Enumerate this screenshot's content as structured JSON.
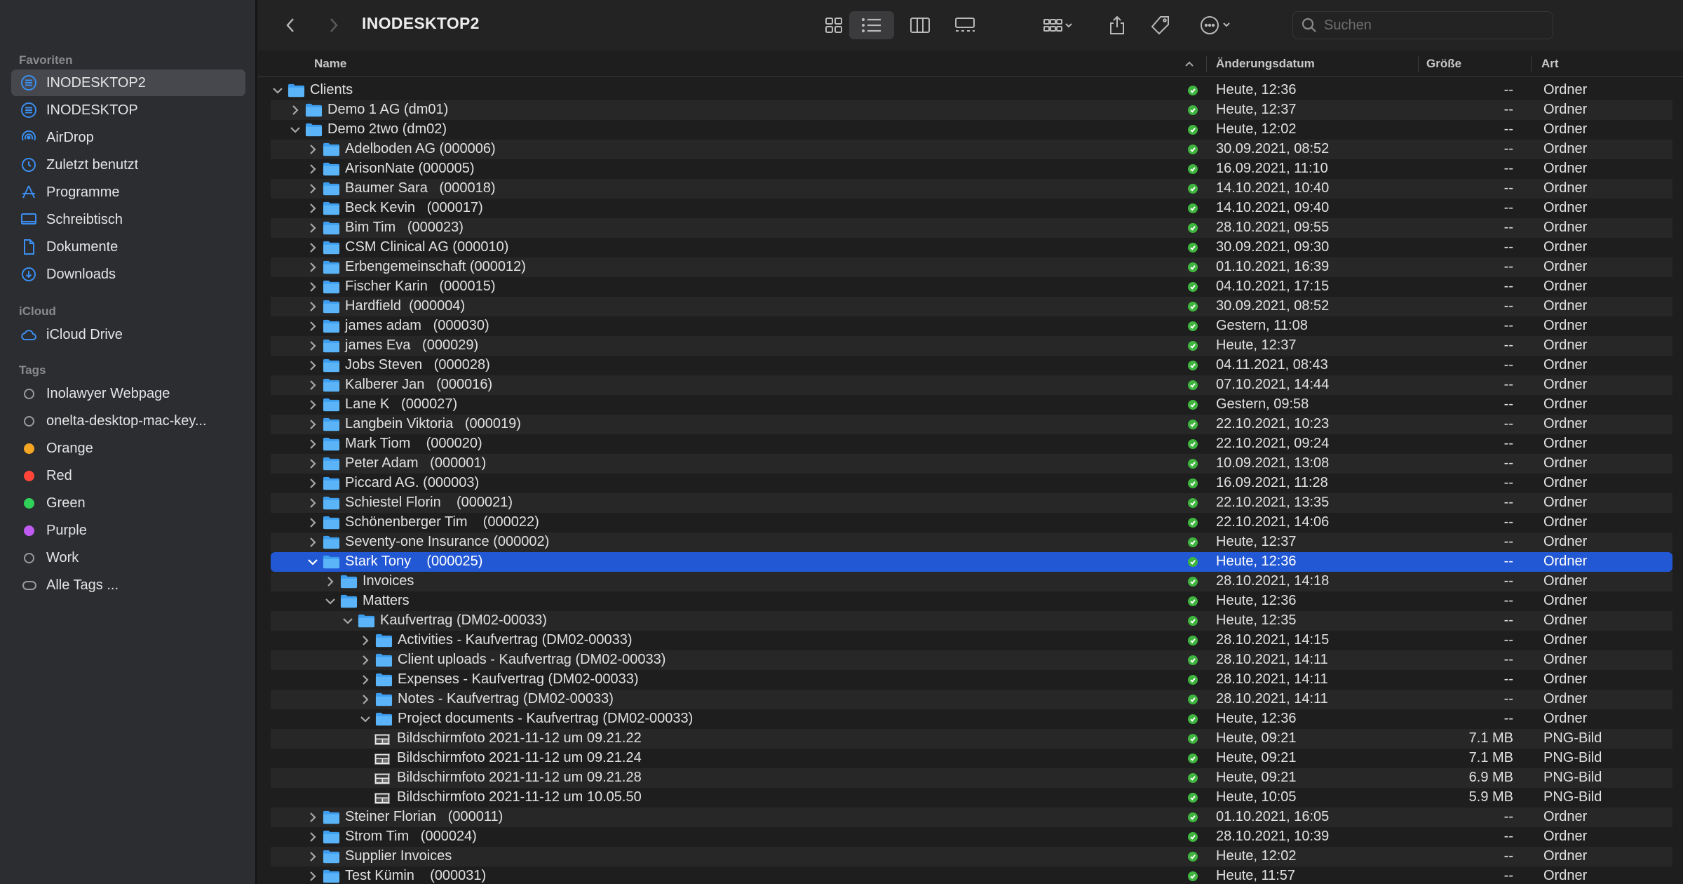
{
  "sidebar": {
    "favorites_title": "Favoriten",
    "favorites": [
      {
        "label": "INODESKTOP2",
        "icon": "server-icon",
        "active": true
      },
      {
        "label": "INODESKTOP",
        "icon": "server-icon",
        "active": false
      },
      {
        "label": "AirDrop",
        "icon": "airdrop-icon",
        "active": false
      },
      {
        "label": "Zuletzt benutzt",
        "icon": "clock-icon",
        "active": false
      },
      {
        "label": "Programme",
        "icon": "apps-icon",
        "active": false
      },
      {
        "label": "Schreibtisch",
        "icon": "desktop-icon",
        "active": false
      },
      {
        "label": "Dokumente",
        "icon": "document-icon",
        "active": false
      },
      {
        "label": "Downloads",
        "icon": "download-icon",
        "active": false
      }
    ],
    "icloud_title": "iCloud",
    "icloud": [
      {
        "label": "iCloud Drive",
        "icon": "cloud-icon"
      }
    ],
    "tags_title": "Tags",
    "tags": [
      {
        "label": "Inolawyer Webpage",
        "color": "none"
      },
      {
        "label": "onelta-desktop-mac-key...",
        "color": "none"
      },
      {
        "label": "Orange",
        "color": "#f5a623"
      },
      {
        "label": "Red",
        "color": "#ff453a"
      },
      {
        "label": "Green",
        "color": "#30d158"
      },
      {
        "label": "Purple",
        "color": "#bf5af2"
      },
      {
        "label": "Work",
        "color": "none"
      },
      {
        "label": "Alle Tags ...",
        "color": "all"
      }
    ]
  },
  "toolbar": {
    "title": "INODESKTOP2",
    "search_placeholder": "Suchen"
  },
  "columns": {
    "name": "Name",
    "date": "Änderungsdatum",
    "size": "Größe",
    "kind": "Art"
  },
  "rows": [
    {
      "name": "Clients",
      "level": 0,
      "expanded": true,
      "type": "folder",
      "date": "Heute, 12:36",
      "size": "--",
      "kind": "Ordner"
    },
    {
      "name": "Demo 1 AG (dm01)",
      "level": 1,
      "expanded": false,
      "type": "folder",
      "date": "Heute, 12:37",
      "size": "--",
      "kind": "Ordner"
    },
    {
      "name": "Demo 2two (dm02)",
      "level": 1,
      "expanded": true,
      "type": "folder",
      "date": "Heute, 12:02",
      "size": "--",
      "kind": "Ordner"
    },
    {
      "name": "Adelboden AG (000006)",
      "level": 2,
      "expanded": false,
      "type": "folder",
      "date": "30.09.2021, 08:52",
      "size": "--",
      "kind": "Ordner"
    },
    {
      "name": "ArisonNate (000005)",
      "level": 2,
      "expanded": false,
      "type": "folder",
      "date": "16.09.2021, 11:10",
      "size": "--",
      "kind": "Ordner"
    },
    {
      "name": "Baumer Sara   (000018)",
      "level": 2,
      "expanded": false,
      "type": "folder",
      "date": "14.10.2021, 10:40",
      "size": "--",
      "kind": "Ordner"
    },
    {
      "name": "Beck Kevin   (000017)",
      "level": 2,
      "expanded": false,
      "type": "folder",
      "date": "14.10.2021, 09:40",
      "size": "--",
      "kind": "Ordner"
    },
    {
      "name": "Bim Tim   (000023)",
      "level": 2,
      "expanded": false,
      "type": "folder",
      "date": "28.10.2021, 09:55",
      "size": "--",
      "kind": "Ordner"
    },
    {
      "name": "CSM Clinical AG (000010)",
      "level": 2,
      "expanded": false,
      "type": "folder",
      "date": "30.09.2021, 09:30",
      "size": "--",
      "kind": "Ordner"
    },
    {
      "name": "Erbengemeinschaft (000012)",
      "level": 2,
      "expanded": false,
      "type": "folder",
      "date": "01.10.2021, 16:39",
      "size": "--",
      "kind": "Ordner"
    },
    {
      "name": "Fischer Karin   (000015)",
      "level": 2,
      "expanded": false,
      "type": "folder",
      "date": "04.10.2021, 17:15",
      "size": "--",
      "kind": "Ordner"
    },
    {
      "name": "Hardfield  (000004)",
      "level": 2,
      "expanded": false,
      "type": "folder",
      "date": "30.09.2021, 08:52",
      "size": "--",
      "kind": "Ordner"
    },
    {
      "name": "james adam   (000030)",
      "level": 2,
      "expanded": false,
      "type": "folder",
      "date": "Gestern, 11:08",
      "size": "--",
      "kind": "Ordner"
    },
    {
      "name": "james Eva   (000029)",
      "level": 2,
      "expanded": false,
      "type": "folder",
      "date": "Heute, 12:37",
      "size": "--",
      "kind": "Ordner"
    },
    {
      "name": "Jobs Steven   (000028)",
      "level": 2,
      "expanded": false,
      "type": "folder",
      "date": "04.11.2021, 08:43",
      "size": "--",
      "kind": "Ordner"
    },
    {
      "name": "Kalberer Jan   (000016)",
      "level": 2,
      "expanded": false,
      "type": "folder",
      "date": "07.10.2021, 14:44",
      "size": "--",
      "kind": "Ordner"
    },
    {
      "name": "Lane K   (000027)",
      "level": 2,
      "expanded": false,
      "type": "folder",
      "date": "Gestern, 09:58",
      "size": "--",
      "kind": "Ordner"
    },
    {
      "name": "Langbein Viktoria   (000019)",
      "level": 2,
      "expanded": false,
      "type": "folder",
      "date": "22.10.2021, 10:23",
      "size": "--",
      "kind": "Ordner"
    },
    {
      "name": "Mark Tiom    (000020)",
      "level": 2,
      "expanded": false,
      "type": "folder",
      "date": "22.10.2021, 09:24",
      "size": "--",
      "kind": "Ordner"
    },
    {
      "name": "Peter Adam   (000001)",
      "level": 2,
      "expanded": false,
      "type": "folder",
      "date": "10.09.2021, 13:08",
      "size": "--",
      "kind": "Ordner"
    },
    {
      "name": "Piccard AG. (000003)",
      "level": 2,
      "expanded": false,
      "type": "folder",
      "date": "16.09.2021, 11:28",
      "size": "--",
      "kind": "Ordner"
    },
    {
      "name": "Schiestel Florin    (000021)",
      "level": 2,
      "expanded": false,
      "type": "folder",
      "date": "22.10.2021, 13:35",
      "size": "--",
      "kind": "Ordner"
    },
    {
      "name": "Schönenberger Tim    (000022)",
      "level": 2,
      "expanded": false,
      "type": "folder",
      "date": "22.10.2021, 14:06",
      "size": "--",
      "kind": "Ordner"
    },
    {
      "name": "Seventy-one Insurance (000002)",
      "level": 2,
      "expanded": false,
      "type": "folder",
      "date": "Heute, 12:37",
      "size": "--",
      "kind": "Ordner"
    },
    {
      "name": "Stark Tony    (000025)",
      "level": 2,
      "expanded": true,
      "type": "folder",
      "selected": true,
      "date": "Heute, 12:36",
      "size": "--",
      "kind": "Ordner"
    },
    {
      "name": "Invoices",
      "level": 3,
      "expanded": false,
      "type": "folder",
      "date": "28.10.2021, 14:18",
      "size": "--",
      "kind": "Ordner"
    },
    {
      "name": "Matters",
      "level": 3,
      "expanded": true,
      "type": "folder",
      "date": "Heute, 12:36",
      "size": "--",
      "kind": "Ordner"
    },
    {
      "name": "Kaufvertrag (DM02-00033)",
      "level": 4,
      "expanded": true,
      "type": "folder",
      "date": "Heute, 12:35",
      "size": "--",
      "kind": "Ordner"
    },
    {
      "name": "Activities - Kaufvertrag (DM02-00033)",
      "level": 5,
      "expanded": false,
      "type": "folder",
      "date": "28.10.2021, 14:15",
      "size": "--",
      "kind": "Ordner"
    },
    {
      "name": "Client uploads - Kaufvertrag (DM02-00033)",
      "level": 5,
      "expanded": false,
      "type": "folder",
      "date": "28.10.2021, 14:11",
      "size": "--",
      "kind": "Ordner"
    },
    {
      "name": "Expenses - Kaufvertrag (DM02-00033)",
      "level": 5,
      "expanded": false,
      "type": "folder",
      "date": "28.10.2021, 14:11",
      "size": "--",
      "kind": "Ordner"
    },
    {
      "name": "Notes - Kaufvertrag (DM02-00033)",
      "level": 5,
      "expanded": false,
      "type": "folder",
      "date": "28.10.2021, 14:11",
      "size": "--",
      "kind": "Ordner"
    },
    {
      "name": "Project documents - Kaufvertrag (DM02-00033)",
      "level": 5,
      "expanded": true,
      "type": "folder",
      "date": "Heute, 12:36",
      "size": "--",
      "kind": "Ordner"
    },
    {
      "name": "Bildschirmfoto 2021-11-12 um 09.21.22",
      "level": 6,
      "type": "image",
      "date": "Heute, 09:21",
      "size": "7.1 MB",
      "kind": "PNG-Bild"
    },
    {
      "name": "Bildschirmfoto 2021-11-12 um 09.21.24",
      "level": 6,
      "type": "image",
      "date": "Heute, 09:21",
      "size": "7.1 MB",
      "kind": "PNG-Bild"
    },
    {
      "name": "Bildschirmfoto 2021-11-12 um 09.21.28",
      "level": 6,
      "type": "image",
      "date": "Heute, 09:21",
      "size": "6.9 MB",
      "kind": "PNG-Bild"
    },
    {
      "name": "Bildschirmfoto 2021-11-12 um 10.05.50",
      "level": 6,
      "type": "image",
      "date": "Heute, 10:05",
      "size": "5.9 MB",
      "kind": "PNG-Bild"
    },
    {
      "name": "Steiner Florian   (000011)",
      "level": 2,
      "expanded": false,
      "type": "folder",
      "date": "01.10.2021, 16:05",
      "size": "--",
      "kind": "Ordner"
    },
    {
      "name": "Strom Tim   (000024)",
      "level": 2,
      "expanded": false,
      "type": "folder",
      "date": "28.10.2021, 10:39",
      "size": "--",
      "kind": "Ordner"
    },
    {
      "name": "Supplier Invoices",
      "level": 2,
      "expanded": false,
      "type": "folder",
      "date": "Heute, 12:02",
      "size": "--",
      "kind": "Ordner"
    },
    {
      "name": "Test Kümin    (000031)",
      "level": 2,
      "expanded": false,
      "type": "folder",
      "date": "Heute, 11:57",
      "size": "--",
      "kind": "Ordner"
    }
  ]
}
